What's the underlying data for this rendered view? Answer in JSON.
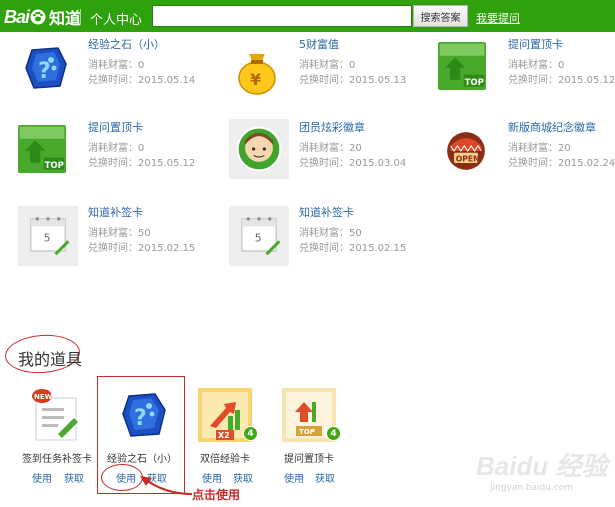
{
  "header": {
    "logo_text": "Bai",
    "logo_product": "知道",
    "center_link": "个人中心",
    "search_placeholder": "",
    "search_button": "搜索答案",
    "ask_link": "我要提问"
  },
  "labels": {
    "cost": "消耗财富：",
    "time": "兑换时间："
  },
  "exchanged": [
    {
      "title": "经验之石（小）",
      "cost": "0",
      "time": "2015.05.14",
      "icon": "blue-stone-icon"
    },
    {
      "title": "5财富值",
      "cost": "0",
      "time": "2015.05.13",
      "icon": "money-bag-icon"
    },
    {
      "title": "提问置顶卡",
      "cost": "0",
      "time": "2015.05.12",
      "icon": "top-card-icon"
    },
    {
      "title": "提问置顶卡",
      "cost": "0",
      "time": "2015.05.12",
      "icon": "top-card-icon"
    },
    {
      "title": "团员炫彩徽章",
      "cost": "20",
      "time": "2015.03.04",
      "icon": "avatar-badge-icon"
    },
    {
      "title": "新版商城纪念徽章",
      "cost": "20",
      "time": "2015.02.24",
      "icon": "open-badge-icon"
    },
    {
      "title": "知道补签卡",
      "cost": "50",
      "time": "2015.02.15",
      "icon": "calendar-card-icon"
    },
    {
      "title": "知道补签卡",
      "cost": "50",
      "time": "2015.02.15",
      "icon": "calendar-card-icon"
    }
  ],
  "my_tools": {
    "title": "我的道具",
    "use_label": "使用",
    "get_label": "获取",
    "items": [
      {
        "name": "签到任务补签卡",
        "icon": "new-checkin-card-icon",
        "badge": ""
      },
      {
        "name": "经验之石（小）",
        "icon": "blue-stone-icon",
        "badge": ""
      },
      {
        "name": "双倍经验卡",
        "icon": "double-exp-card-icon",
        "badge": "4"
      },
      {
        "name": "提问置顶卡",
        "icon": "top-card-icon",
        "badge": "4"
      }
    ]
  },
  "annotation": {
    "click_use": "点击使用"
  },
  "watermark": {
    "main": "Baidu 经验",
    "sub": "jingyan.baidu.com"
  },
  "colors": {
    "brand_green": "#2ea10c",
    "link_blue": "#2c68a8",
    "annotation_red": "#cc2a2a"
  }
}
